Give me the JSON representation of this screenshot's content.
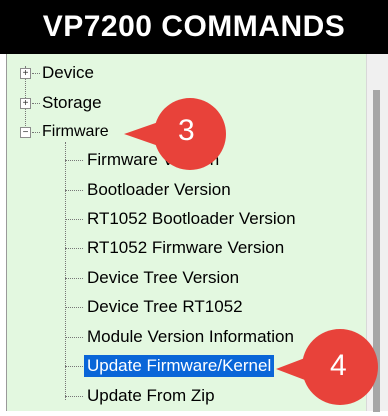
{
  "header": {
    "title": "VP7200 COMMANDS"
  },
  "tree": {
    "top_items": [
      {
        "label": "Device",
        "expander": "+"
      },
      {
        "label": "Storage",
        "expander": "+"
      },
      {
        "label": "Firmware",
        "expander": "−"
      }
    ],
    "firmware_children": [
      {
        "label": "Firmware Version"
      },
      {
        "label": "Bootloader Version"
      },
      {
        "label": "RT1052 Bootloader Version"
      },
      {
        "label": "RT1052 Firmware Version"
      },
      {
        "label": "Device Tree Version"
      },
      {
        "label": "Device Tree RT1052"
      },
      {
        "label": "Module Version Information"
      },
      {
        "label": "Update Firmware/Kernel",
        "selected": true
      },
      {
        "label": "Update From Zip"
      }
    ]
  },
  "callouts": [
    {
      "number": "3",
      "color": "#e8423a"
    },
    {
      "number": "4",
      "color": "#e8423a"
    }
  ],
  "colors": {
    "panel_bg": "#e3f8e0",
    "selection": "#0a66d8",
    "callout": "#e8423a"
  }
}
